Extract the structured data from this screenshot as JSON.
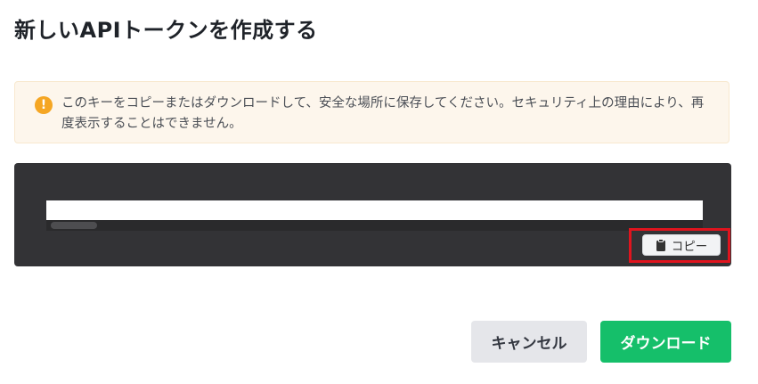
{
  "dialog": {
    "title": "新しいAPIトークンを作成する",
    "warning": {
      "icon": "exclamation-circle-icon",
      "text": "このキーをコピーまたはダウンロードして、安全な場所に保存してください。セキュリティ上の理由により、再度表示することはできません。"
    },
    "token": {
      "value": ""
    },
    "copy_button": {
      "icon": "clipboard-icon",
      "label": "コピー"
    },
    "cancel_button": "キャンセル",
    "download_button": "ダウンロード"
  },
  "colors": {
    "warning_bg": "#fdf6ec",
    "warning_icon": "#f5a623",
    "token_box_bg": "#333336",
    "download_button": "#15bf6a",
    "highlight": "#e0141e"
  }
}
